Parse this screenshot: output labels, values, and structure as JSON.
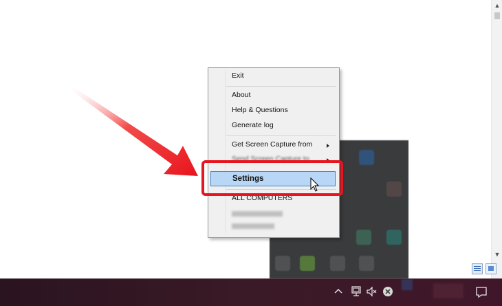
{
  "context_menu": {
    "items": [
      {
        "label": "Exit"
      },
      {
        "label": "About"
      },
      {
        "label": "Help & Questions"
      },
      {
        "label": "Generate log"
      },
      {
        "label": "Get Screen Capture from"
      },
      {
        "label": "Send Screen Capture to"
      },
      {
        "label": "Settings",
        "state": "hovered"
      },
      {
        "label": "ALL COMPUTERS"
      }
    ]
  },
  "taskbar": {
    "icons": [
      "chevron-up-icon",
      "network-icon",
      "volume-muted-icon",
      "close-circle-icon",
      "notification-icon"
    ]
  },
  "annotation": {
    "color": "#e8151e"
  },
  "colors": {
    "taskbar": "#3a1a26",
    "menu_background": "#f0f0f0",
    "menu_highlight": "#b8d6f5"
  }
}
